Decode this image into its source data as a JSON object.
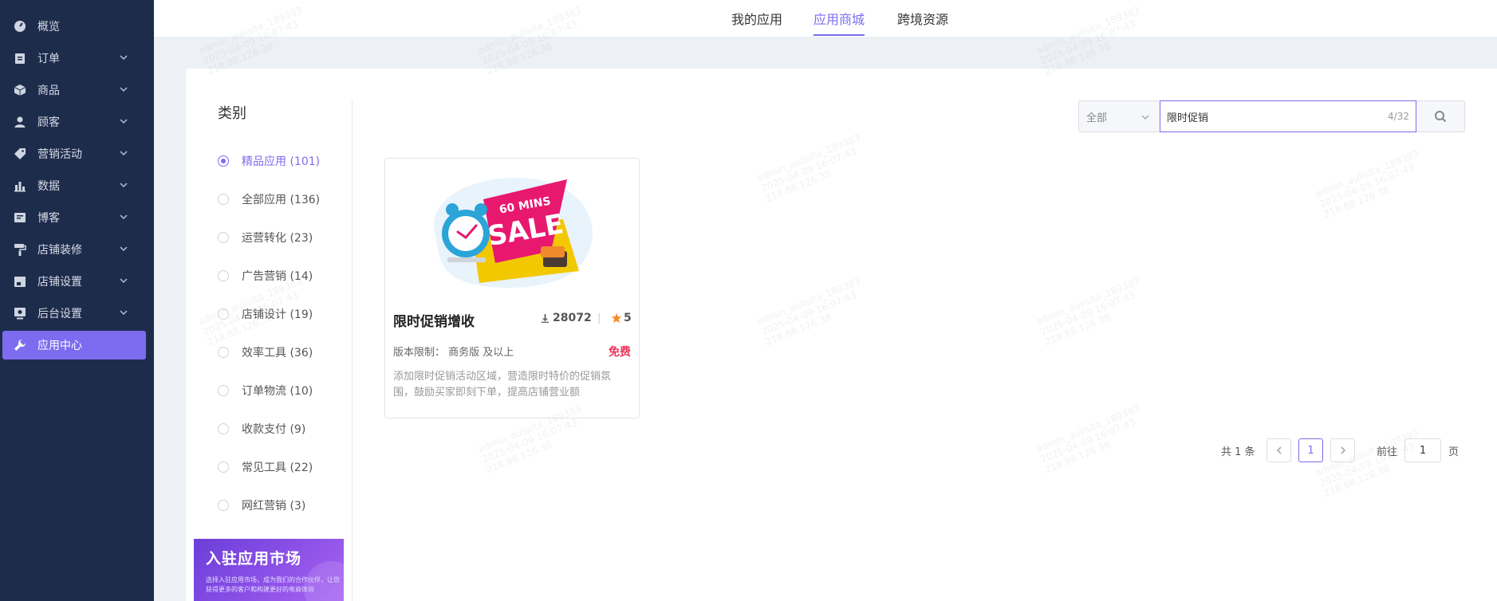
{
  "sidebar": {
    "items": [
      {
        "label": "概览",
        "icon": "dashboard-icon",
        "expandable": false
      },
      {
        "label": "订单",
        "icon": "clipboard-icon",
        "expandable": true
      },
      {
        "label": "商品",
        "icon": "box-icon",
        "expandable": true
      },
      {
        "label": "顾客",
        "icon": "user-icon",
        "expandable": true
      },
      {
        "label": "营销活动",
        "icon": "tag-icon",
        "expandable": true
      },
      {
        "label": "数据",
        "icon": "bar-chart-icon",
        "expandable": true
      },
      {
        "label": "博客",
        "icon": "blog-icon",
        "expandable": true
      },
      {
        "label": "店铺装修",
        "icon": "paint-roller-icon",
        "expandable": true
      },
      {
        "label": "店铺设置",
        "icon": "store-icon",
        "expandable": true
      },
      {
        "label": "后台设置",
        "icon": "admin-monitor-icon",
        "expandable": true
      },
      {
        "label": "应用中心",
        "icon": "wrench-icon",
        "expandable": false,
        "active": true
      }
    ]
  },
  "tabs": [
    {
      "label": "我的应用"
    },
    {
      "label": "应用商城",
      "active": true
    },
    {
      "label": "跨境资源"
    }
  ],
  "categories": {
    "title": "类别",
    "items": [
      {
        "label": "精品应用 (101)",
        "selected": true
      },
      {
        "label": "全部应用 (136)"
      },
      {
        "label": "运营转化 (23)"
      },
      {
        "label": "广告营销 (14)"
      },
      {
        "label": "店铺设计 (19)"
      },
      {
        "label": "效率工具 (36)"
      },
      {
        "label": "订单物流 (10)"
      },
      {
        "label": "收款支付 (9)"
      },
      {
        "label": "常见工具 (22)"
      },
      {
        "label": "网红营销 (3)"
      }
    ]
  },
  "banner": {
    "title": "入驻应用市场",
    "desc": "选择入驻应用市场，成为我们的合作伙伴，让您获得更多的客户和构建更好的电商体验"
  },
  "search": {
    "scope": "全部",
    "value": "限时促销",
    "count": "4/32"
  },
  "apps": [
    {
      "name": "限时促销增收",
      "downloads": "28072",
      "rating": "5",
      "version": "版本限制： 商务版 及以上",
      "price": "免费",
      "desc": "添加限时促销活动区域，营造限时特价的促销氛围，鼓励买家即刻下单，提高店铺营业额",
      "image_text_top": "60 MINS",
      "image_text_main": "SALE"
    }
  ],
  "pagination": {
    "total": "共 1 条",
    "current": "1",
    "goto_label": "前往",
    "goto_value": "1",
    "page_suffix": "页"
  },
  "watermark": {
    "line1": "admin_aulisita_189383",
    "line2": "2025-04-09 16:07:43",
    "line3": "218.88.126.38"
  },
  "colors": {
    "accent": "#7d6cf0",
    "sidebar_bg": "#1e2c4c",
    "price": "#e8365b"
  }
}
